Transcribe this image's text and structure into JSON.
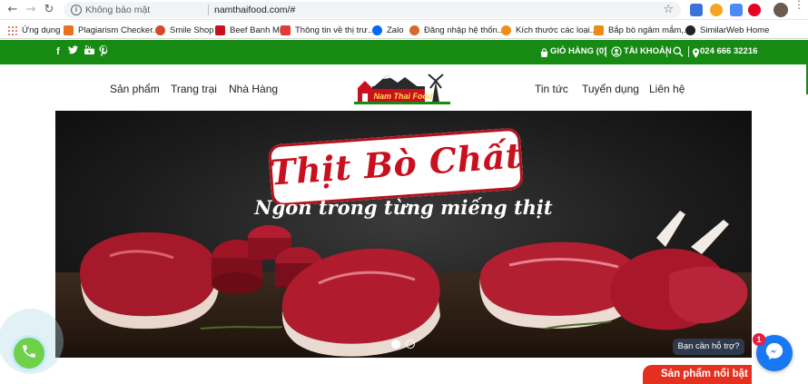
{
  "browser": {
    "info_icon": "i",
    "security_label": "Không bảo mật",
    "url": "namthaifood.com/#",
    "star_icon": "star-icon",
    "menu_icon": "⋮"
  },
  "bookmarks": [
    {
      "label": "Ứng dụng",
      "color": "#e8453c"
    },
    {
      "label": "Plagiarism Checker...",
      "color": "#e8731e"
    },
    {
      "label": "Smile Shop",
      "color": "#d24a2a"
    },
    {
      "label": "Beef Banh Mi",
      "color": "#c8101e"
    },
    {
      "label": "Thông tin về thị trư...",
      "color": "#e53935"
    },
    {
      "label": "Zalo",
      "color": "#0068ff"
    },
    {
      "label": "Đăng nhập hệ thốn...",
      "color": "#d9662a"
    },
    {
      "label": "Kích thước các loại...",
      "color": "#f08c1a"
    },
    {
      "label": "Bắp bò ngâm mắm,...",
      "color": "#ef8a12"
    },
    {
      "label": "SimilarWeb Home",
      "color": "#222222"
    }
  ],
  "topbar": {
    "social": [
      "f",
      "t",
      "yt",
      "p"
    ],
    "cart_label": "GIỎ HÀNG (0)",
    "account_label": "TÀI KHOẢN",
    "phone": "024 666 32216"
  },
  "nav": {
    "left": [
      "Sản phẩm",
      "Trang trại",
      "Nhà Hàng"
    ],
    "right": [
      "Tin tức",
      "Tuyển dụng",
      "Liên hệ"
    ],
    "logo_text": "Nam Thai Food"
  },
  "hero": {
    "title": "Thịt Bò Chất",
    "subtitle": "Ngon trong từng miếng thịt",
    "slides": 2,
    "active_slide": 1
  },
  "widgets": {
    "help_label": "Bạn cần hỗ trợ?",
    "message_badge": "1",
    "featured_label": "Sản phẩm nổi bật"
  },
  "colors": {
    "brand_green": "#168a12",
    "accent_red": "#e5301f",
    "messenger_blue": "#1877f2"
  }
}
